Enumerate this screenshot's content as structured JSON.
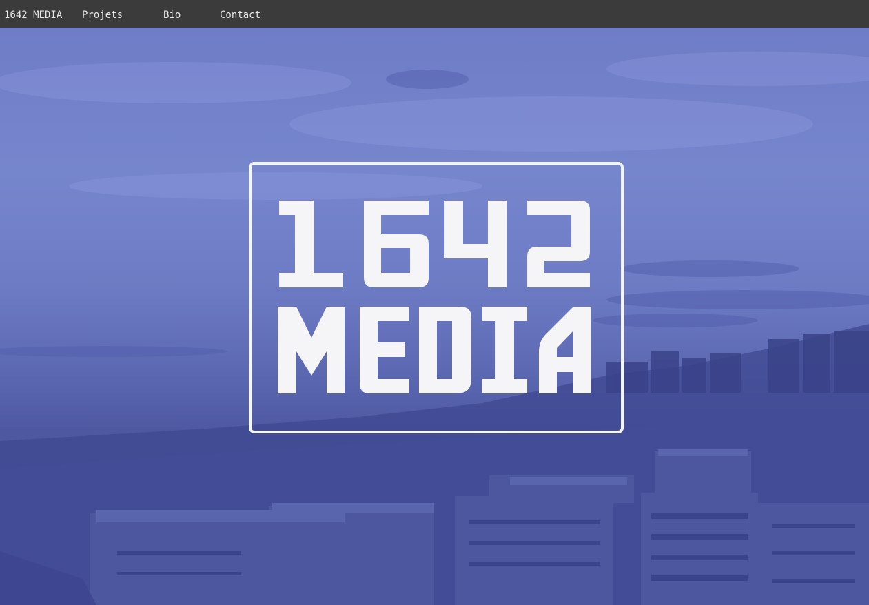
{
  "nav": {
    "brand": "1642 MEDIA",
    "items": [
      {
        "label": "Projets"
      },
      {
        "label": "Bio"
      },
      {
        "label": "Contact"
      }
    ]
  },
  "hero": {
    "logo_line1": "1642",
    "logo_line2": "MEDIA",
    "logo_color": "#f5f5f7",
    "tint_color": "#5866b8"
  },
  "colors": {
    "topbar": "#3b3b3b",
    "nav_text": "#e8e8e8"
  }
}
